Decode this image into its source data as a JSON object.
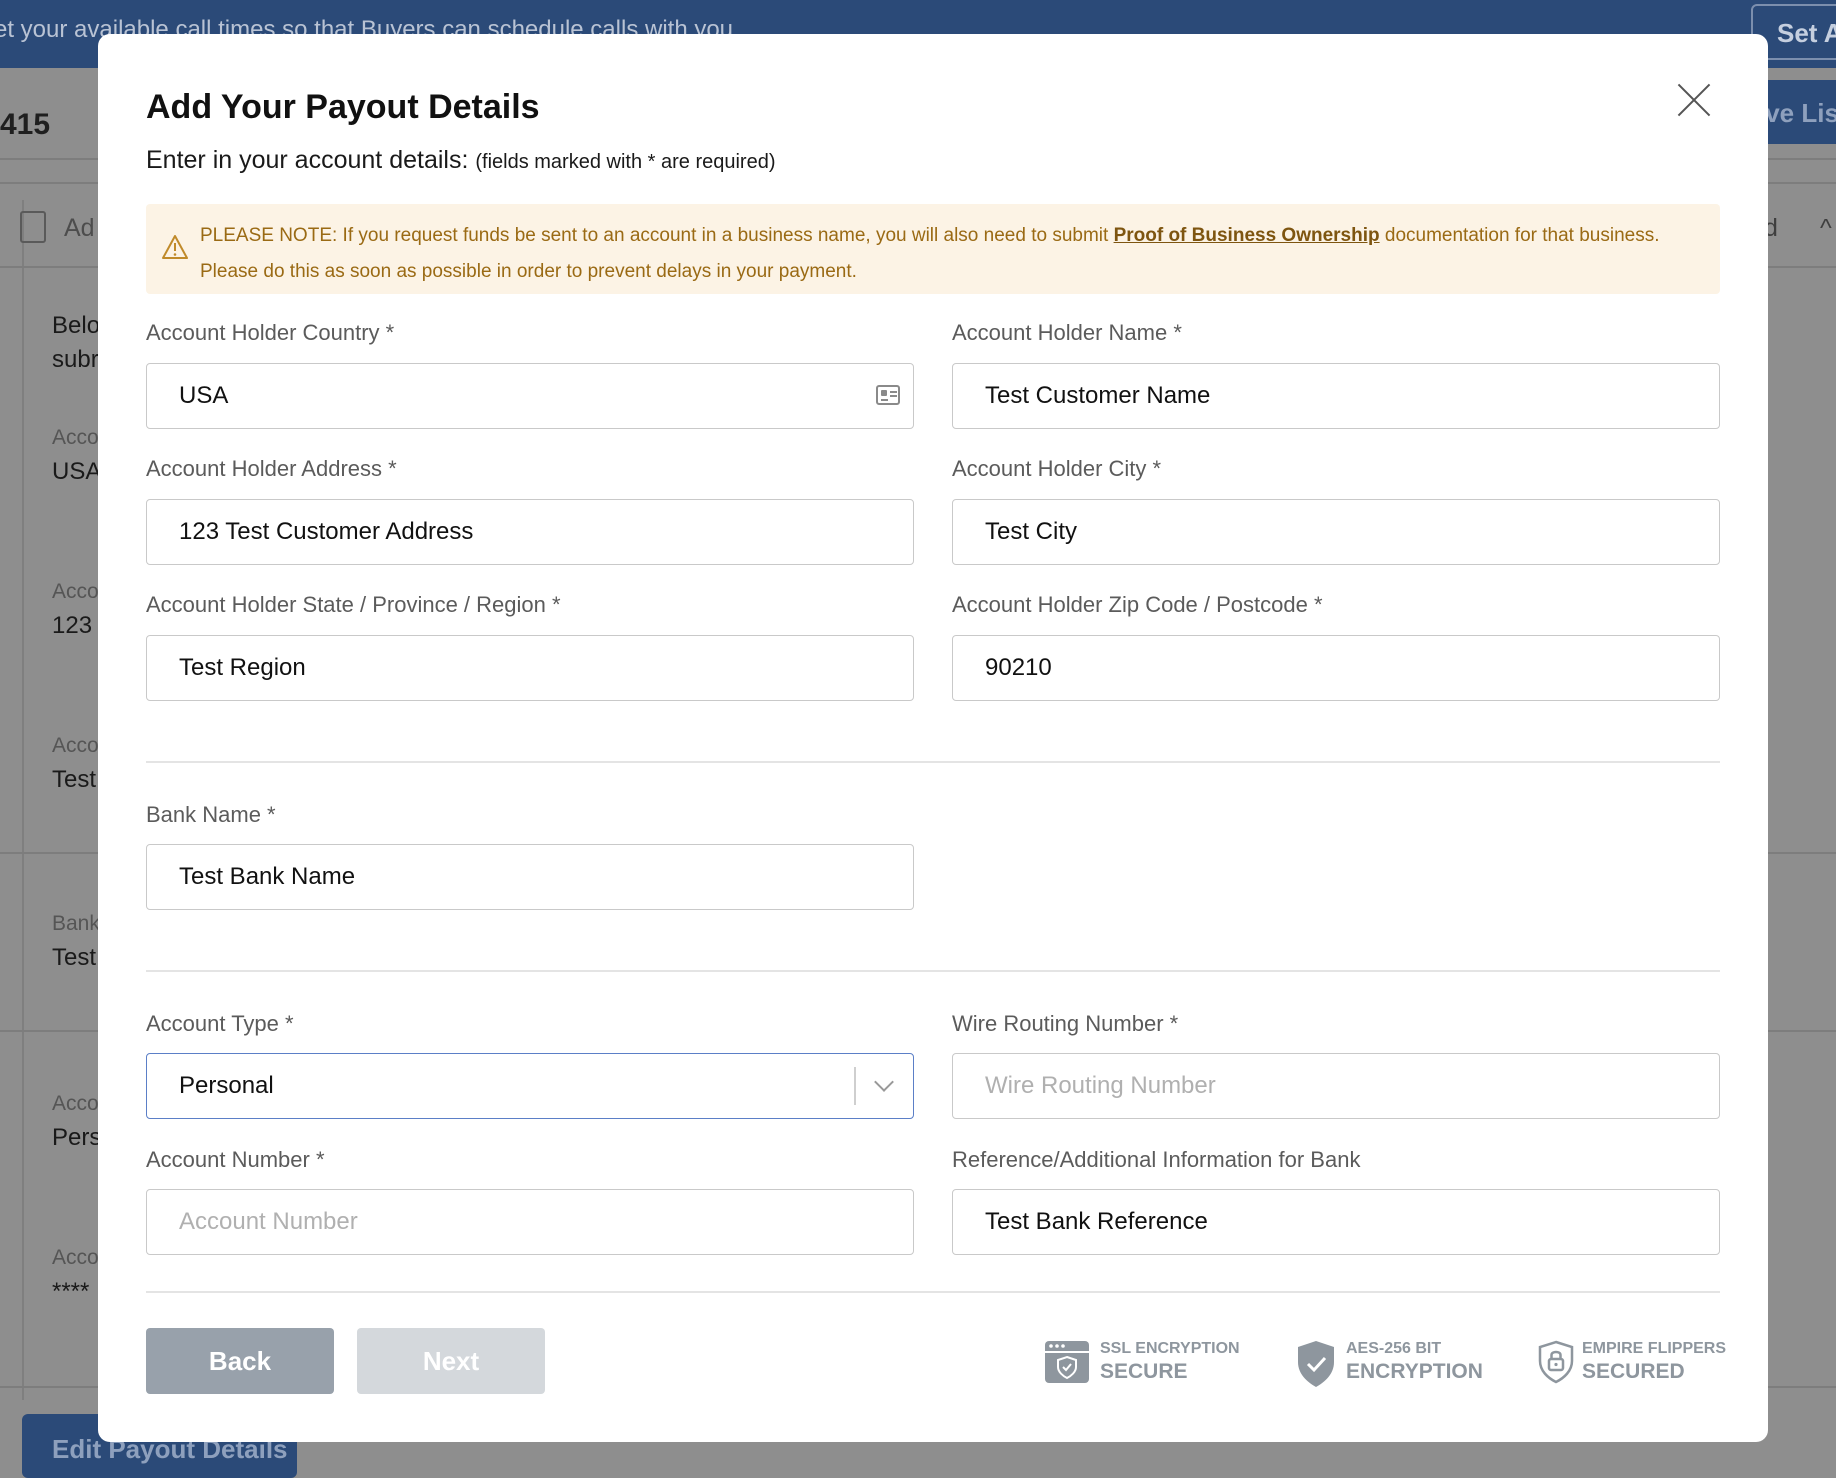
{
  "background": {
    "banner_text": "et your available call times so that Buyers can schedule calls with you.",
    "banner_button": "Set Av",
    "listing_id": "415",
    "live_button": "ive Lis",
    "tab_text": "Ad",
    "right_fragment": "d",
    "fields": [
      {
        "label": "Belo",
        "value": "subr"
      },
      {
        "label": "Acco",
        "value": "USA"
      },
      {
        "label": "Acco",
        "value": "123"
      },
      {
        "label": "Acco",
        "value": "Test"
      },
      {
        "label": "Bank",
        "value": "Test"
      },
      {
        "label": "Acco",
        "value": "Pers"
      },
      {
        "label": "Acco",
        "value": "****"
      }
    ],
    "edit_button": "Edit Payout Details"
  },
  "modal": {
    "title": "Add Your Payout Details",
    "subtitle": "Enter in your account details:",
    "subtitle_note": "(fields marked with * are required)",
    "notice": {
      "text_before": "PLEASE NOTE: If you request funds be sent to an account in a business name, you will also need to submit ",
      "link": "Proof of Business Ownership",
      "text_after": " documentation for that business. Please do this as soon as possible in order to prevent delays in your payment."
    },
    "fields": {
      "country": {
        "label": "Account Holder Country *",
        "value": "USA"
      },
      "name": {
        "label": "Account Holder Name *",
        "value": "Test Customer Name"
      },
      "address": {
        "label": "Account Holder Address *",
        "value": "123 Test Customer Address"
      },
      "city": {
        "label": "Account Holder City *",
        "value": "Test City"
      },
      "state": {
        "label": "Account Holder State / Province / Region *",
        "value": "Test Region"
      },
      "zip": {
        "label": "Account Holder Zip Code / Postcode *",
        "value": "90210"
      },
      "bank_name": {
        "label": "Bank Name *",
        "value": "Test Bank Name"
      },
      "account_type": {
        "label": "Account Type *",
        "value": "Personal"
      },
      "wire_routing": {
        "label": "Wire Routing Number *",
        "value": "",
        "placeholder": "Wire Routing Number"
      },
      "account_number": {
        "label": "Account Number *",
        "value": "",
        "placeholder": "Account Number"
      },
      "reference": {
        "label": "Reference/Additional Information for Bank",
        "value": "Test Bank Reference"
      }
    },
    "buttons": {
      "back": "Back",
      "next": "Next"
    },
    "badges": [
      {
        "icon": "ssl-browser-icon",
        "top": "SSL ENCRYPTION",
        "bottom": "SECURE"
      },
      {
        "icon": "shield-check-icon",
        "top": "AES-256 BIT",
        "bottom": "ENCRYPTION"
      },
      {
        "icon": "lock-shield-icon",
        "top": "EMPIRE FLIPPERS",
        "bottom": "SECURED"
      }
    ]
  },
  "colors": {
    "brand_navy": "#2b4a78",
    "notice_background": "#fcf3e5",
    "notice_text": "#9a6a14",
    "focus_border": "#5b7fc7",
    "back_button": "#98a1ab",
    "next_button_disabled": "#d4d8dc"
  }
}
